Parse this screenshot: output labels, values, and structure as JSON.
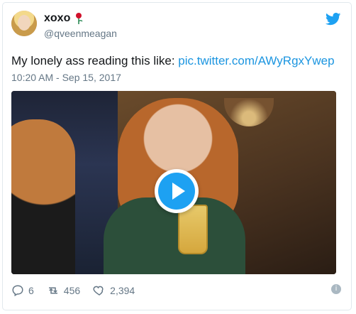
{
  "tweet": {
    "display_name": "xoxo",
    "handle": "@qveenmeagan",
    "text_prefix": "My lonely ass reading this like: ",
    "link_text": "pic.twitter.com/AWyRgxYwep",
    "timestamp": "10:20 AM - Sep 15, 2017",
    "actions": {
      "reply_count": "6",
      "retweet_count": "456",
      "like_count": "2,394"
    }
  },
  "icons": {
    "brand": "twitter-bird-icon",
    "emoji": "rose-icon",
    "info": "info-icon"
  },
  "colors": {
    "link": "#1b95e0",
    "brand": "#1da1f2",
    "muted": "#657786"
  }
}
